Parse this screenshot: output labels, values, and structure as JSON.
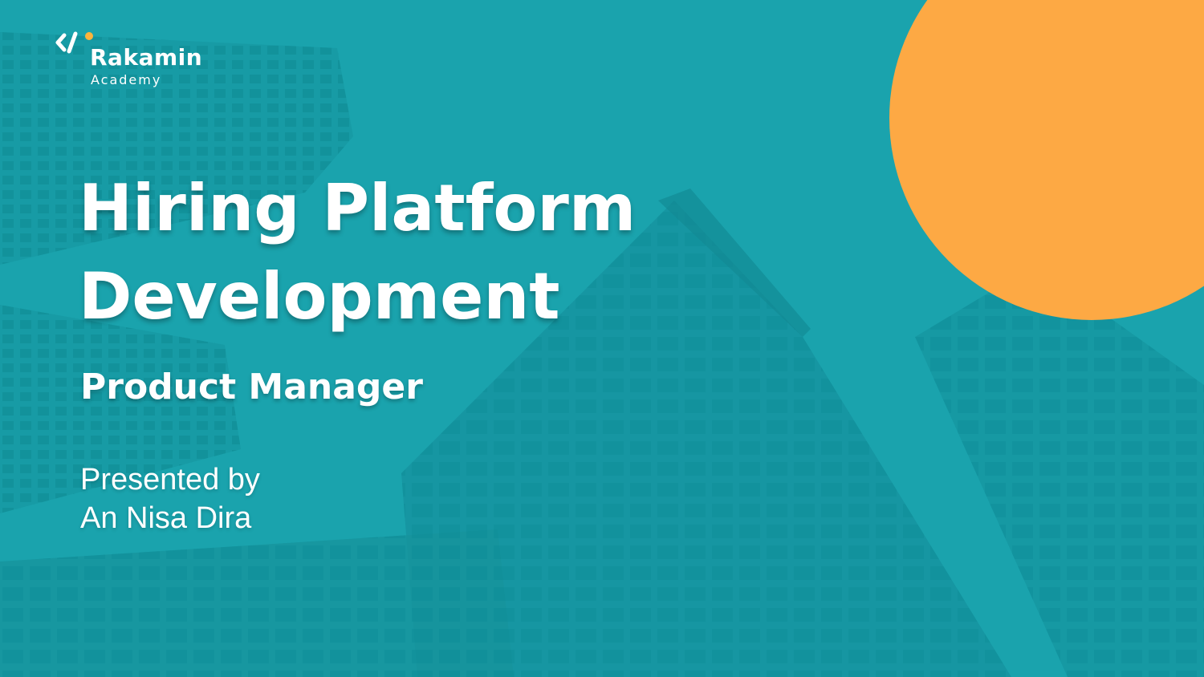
{
  "brand": {
    "name": "Rakamin",
    "subtitle": "Academy",
    "logo_icon": "code-brackets-icon",
    "accent_color": "#fdb43c"
  },
  "slide": {
    "title_line1": "Hiring Platform",
    "title_line2": "Development",
    "subtitle": "Product Manager",
    "presented_label": "Presented by",
    "presenter_name": "An Nisa Dira"
  },
  "colors": {
    "background_teal": "#1aa3ad",
    "circle_orange": "#fda944",
    "text": "#ffffff"
  }
}
